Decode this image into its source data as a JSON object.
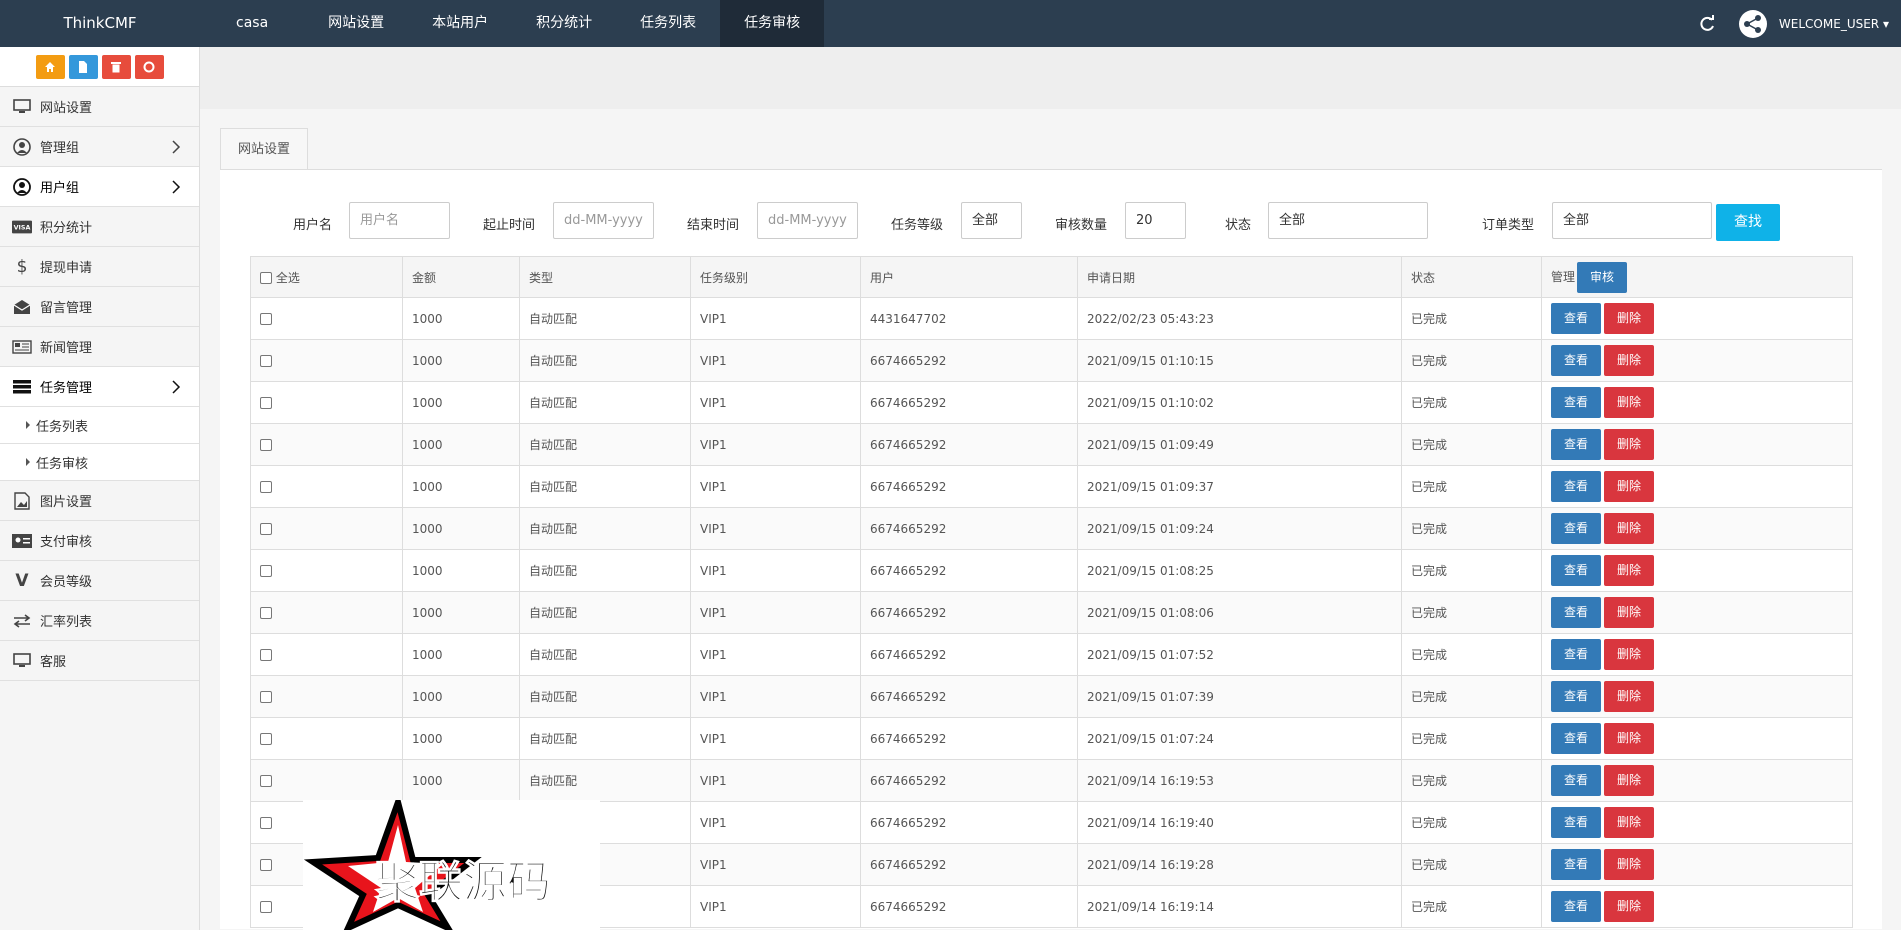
{
  "app": {
    "brand": "ThinkCMF",
    "welcome": "WELCOME_USER"
  },
  "topnav": [
    "casa",
    "网站设置",
    "本站用户",
    "积分统计",
    "任务列表",
    "任务审核"
  ],
  "sidebar": {
    "items": [
      {
        "label": "网站设置",
        "icon": "monitor-icon"
      },
      {
        "label": "管理组",
        "icon": "user-circle-icon",
        "chevron": true
      },
      {
        "label": "用户组",
        "icon": "user-circle-icon",
        "chevron": true
      },
      {
        "label": "积分统计",
        "icon": "visa-icon"
      },
      {
        "label": "提现申请",
        "icon": "dollar-icon"
      },
      {
        "label": "留言管理",
        "icon": "envelope-icon"
      },
      {
        "label": "新闻管理",
        "icon": "newspaper-icon"
      },
      {
        "label": "任务管理",
        "icon": "server-icon",
        "chevron": true
      },
      {
        "label": "图片设置",
        "icon": "image-icon"
      },
      {
        "label": "支付审核",
        "icon": "id-card-icon"
      },
      {
        "label": "会员等级",
        "icon": "vine-icon"
      },
      {
        "label": "汇率列表",
        "icon": "exchange-icon"
      },
      {
        "label": "客服",
        "icon": "monitor-icon"
      }
    ],
    "subitems": [
      "任务列表",
      "任务审核"
    ]
  },
  "tab": "网站设置",
  "filters": {
    "username_label": "用户名",
    "username_placeholder": "用户名",
    "start_label": "起止时间",
    "start_placeholder": "dd-MM-yyyy",
    "end_label": "结束时间",
    "end_placeholder": "dd-MM-yyyy",
    "level_label": "任务等级",
    "level_value": "全部",
    "count_label": "审核数量",
    "count_value": "20",
    "status_label": "状态",
    "status_value": "全部",
    "order_label": "订单类型",
    "order_value": "全部",
    "search_label": "查找"
  },
  "table": {
    "headers": [
      "全选",
      "金额",
      "类型",
      "任务级别",
      "用户",
      "申请日期",
      "状态",
      "管理"
    ],
    "audit_label": "审核",
    "view_label": "查看",
    "delete_label": "删除",
    "rows": [
      [
        "1000",
        "自动匹配",
        "VIP1",
        "4431647702",
        "2022/02/23 05:43:23",
        "已完成"
      ],
      [
        "1000",
        "自动匹配",
        "VIP1",
        "6674665292",
        "2021/09/15 01:10:15",
        "已完成"
      ],
      [
        "1000",
        "自动匹配",
        "VIP1",
        "6674665292",
        "2021/09/15 01:10:02",
        "已完成"
      ],
      [
        "1000",
        "自动匹配",
        "VIP1",
        "6674665292",
        "2021/09/15 01:09:49",
        "已完成"
      ],
      [
        "1000",
        "自动匹配",
        "VIP1",
        "6674665292",
        "2021/09/15 01:09:37",
        "已完成"
      ],
      [
        "1000",
        "自动匹配",
        "VIP1",
        "6674665292",
        "2021/09/15 01:09:24",
        "已完成"
      ],
      [
        "1000",
        "自动匹配",
        "VIP1",
        "6674665292",
        "2021/09/15 01:08:25",
        "已完成"
      ],
      [
        "1000",
        "自动匹配",
        "VIP1",
        "6674665292",
        "2021/09/15 01:08:06",
        "已完成"
      ],
      [
        "1000",
        "自动匹配",
        "VIP1",
        "6674665292",
        "2021/09/15 01:07:52",
        "已完成"
      ],
      [
        "1000",
        "自动匹配",
        "VIP1",
        "6674665292",
        "2021/09/15 01:07:39",
        "已完成"
      ],
      [
        "1000",
        "自动匹配",
        "VIP1",
        "6674665292",
        "2021/09/15 01:07:24",
        "已完成"
      ],
      [
        "1000",
        "自动匹配",
        "VIP1",
        "6674665292",
        "2021/09/14 16:19:53",
        "已完成"
      ],
      [
        "",
        "",
        "VIP1",
        "6674665292",
        "2021/09/14 16:19:40",
        "已完成"
      ],
      [
        "",
        "",
        "VIP1",
        "6674665292",
        "2021/09/14 16:19:28",
        "已完成"
      ],
      [
        "",
        "",
        "VIP1",
        "6674665292",
        "2021/09/14 16:19:14",
        "已完成"
      ]
    ]
  },
  "watermark": "聚联源码",
  "colors": {
    "topbar": "#2c3e50",
    "search": "#0fb2e8",
    "view": "#337ab7",
    "delete": "#d9363e",
    "status": "#2e9b2e"
  }
}
